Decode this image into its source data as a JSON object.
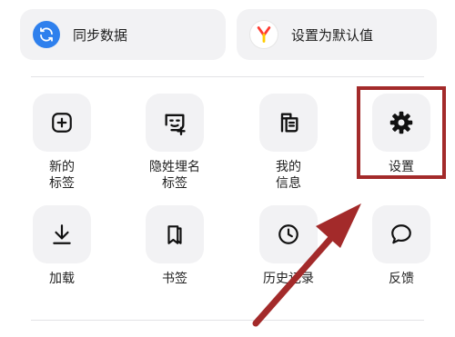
{
  "quick_actions": {
    "sync": {
      "label": "同步数据",
      "icon": "sync-icon",
      "color": "#2f80ed"
    },
    "set_default": {
      "label": "设置为默认值",
      "icon": "yandex-logo-icon",
      "color": "#ff3b30"
    }
  },
  "menu": {
    "new_tab": {
      "label": "新的\n标签",
      "icon": "plus-square-icon"
    },
    "incognito_tab": {
      "label": "隐姓埋名\n标签",
      "icon": "incognito-mask-icon"
    },
    "my_info": {
      "label": "我的\n信息",
      "icon": "id-card-icon"
    },
    "settings": {
      "label": "设置",
      "icon": "gear-icon"
    },
    "downloads": {
      "label": "加载",
      "icon": "download-icon"
    },
    "bookmarks": {
      "label": "书签",
      "icon": "bookmark-icon"
    },
    "history": {
      "label": "历史记录",
      "icon": "clock-icon"
    },
    "feedback": {
      "label": "反馈",
      "icon": "chat-bubble-icon"
    }
  },
  "annotation": {
    "highlight_color": "#a32a2a"
  }
}
